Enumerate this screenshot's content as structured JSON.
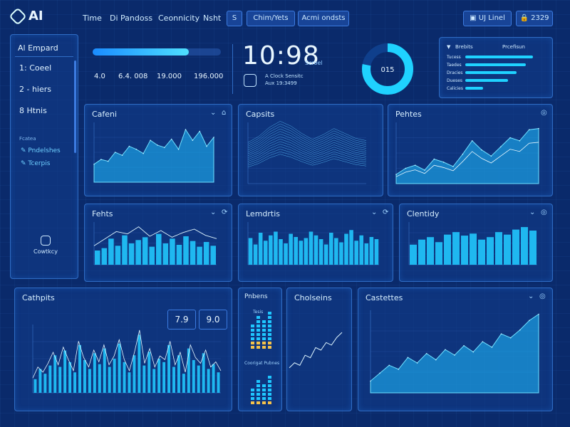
{
  "brand": {
    "logo": "AI"
  },
  "nav": [
    "Time",
    "Di Pandoss",
    "Ceonnicity",
    "Nsht"
  ],
  "nav_buttons": {
    "small": "S",
    "b1": "Chim/Yets",
    "b2": "Acmi ondsts"
  },
  "top_right": {
    "b1": "UJ Linel",
    "b2": "2329"
  },
  "sidebar": {
    "title": "Al Empard",
    "items": [
      "1: Coeel",
      "2 - hiers",
      "8  Htnis"
    ],
    "section": "Fcatea",
    "links": [
      "Pndelshes",
      "Tcerpis"
    ],
    "bottom": "Cowtkcy"
  },
  "summary": {
    "progress": 0.55,
    "progress_label": "",
    "stats": [
      "4.0",
      "6.4. 008",
      "19.000",
      "196.000"
    ]
  },
  "clock": {
    "time": "10:98",
    "sub": "Scroel",
    "note1": "A Clock Sensitc",
    "note2": "Aux 19:3499"
  },
  "donut": {
    "label": "015",
    "value": 0.78
  },
  "legend_panel": {
    "label1": "Brebits",
    "label2": "Prcefisun",
    "rows": [
      {
        "name": "Tucess",
        "v": 0.95
      },
      {
        "name": "Taedes",
        "v": 0.85
      },
      {
        "name": "Dracies",
        "v": 0.72
      },
      {
        "name": "Dueses",
        "v": 0.6
      },
      {
        "name": "Calicies",
        "v": 0.25
      }
    ]
  },
  "panels": {
    "p1": "Cafeni",
    "p2": "Capsits",
    "p3": "Pehtes",
    "p4": "Fehts",
    "p5": "Lemdrtis",
    "p6": "Clentidy",
    "p7": "Cathpits",
    "p8": "Pnbens",
    "p9": "Cholseins",
    "p10": "Castettes"
  },
  "p7_stats": {
    "a": "7.9",
    "b": "9.0"
  },
  "p8_labels": {
    "l1": "Tesis",
    "l2": "Coorigat Pubnes"
  },
  "colors": {
    "accent": "#1fd2ff",
    "fill": "#19a8e6",
    "line": "#6fe0ff"
  },
  "chart_data": [
    {
      "type": "area",
      "values": [
        30,
        38,
        35,
        50,
        45,
        60,
        55,
        48,
        70,
        62,
        58,
        72,
        55,
        88,
        70,
        85,
        60,
        75
      ]
    },
    {
      "type": "line",
      "values": [
        45,
        55,
        70,
        80,
        72,
        60,
        50,
        58,
        68,
        60,
        52,
        48
      ]
    },
    {
      "type": "area",
      "values": [
        15,
        25,
        30,
        22,
        40,
        35,
        28,
        48,
        70,
        55,
        45,
        60,
        75,
        70,
        88,
        90
      ]
    },
    {
      "type": "bar",
      "values": [
        30,
        35,
        55,
        40,
        62,
        45,
        52,
        58,
        38,
        65,
        45,
        55,
        42,
        60,
        50,
        38,
        48,
        40
      ]
    },
    {
      "type": "bar",
      "values": [
        50,
        38,
        60,
        45,
        55,
        62,
        48,
        40,
        58,
        52,
        45,
        50,
        62,
        55,
        48,
        38,
        60,
        50,
        42,
        58,
        65,
        45,
        55,
        40,
        52,
        48
      ]
    },
    {
      "type": "bar",
      "values": [
        40,
        50,
        55,
        45,
        60,
        65,
        58,
        62,
        50,
        55,
        65,
        60,
        70,
        75,
        68
      ]
    },
    {
      "type": "bar",
      "values": [
        20,
        35,
        28,
        40,
        55,
        38,
        62,
        45,
        30,
        70,
        48,
        35,
        58,
        42,
        65,
        38,
        50,
        72,
        45,
        30,
        55,
        85,
        40,
        60,
        35,
        50,
        45,
        70,
        38,
        55,
        28,
        65,
        48,
        40,
        58,
        35,
        42,
        30
      ]
    },
    {
      "type": "line",
      "values": [
        10,
        20,
        15,
        35,
        30,
        50,
        45,
        60,
        55,
        70,
        80
      ]
    },
    {
      "type": "area",
      "values": [
        15,
        25,
        35,
        30,
        45,
        38,
        50,
        42,
        55,
        48,
        60,
        52,
        65,
        58,
        75,
        70,
        80,
        92,
        100
      ]
    }
  ]
}
